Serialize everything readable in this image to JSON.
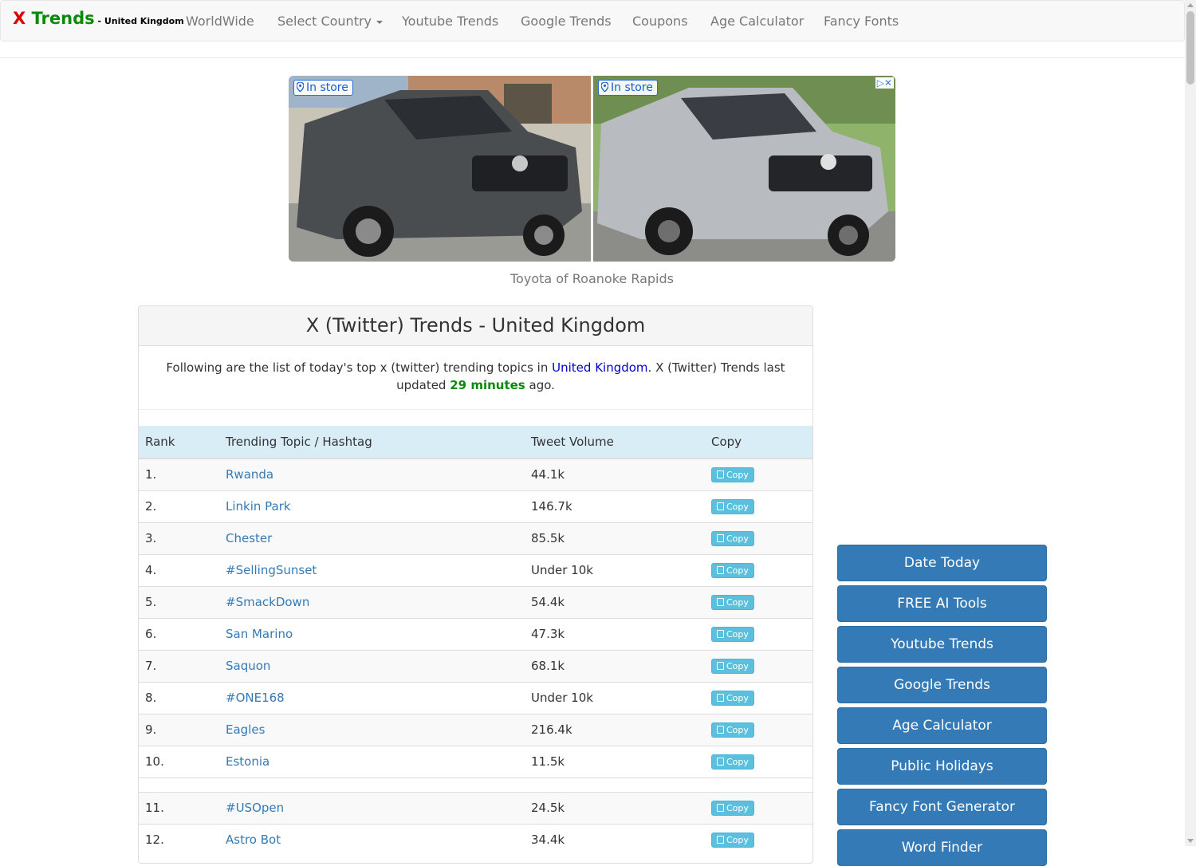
{
  "brand": {
    "x": "X",
    "trends": " Trends",
    "country": " - United Kingdom"
  },
  "nav": {
    "worldwide": "WorldWide",
    "select_country": "Select Country",
    "youtube_trends": "Youtube Trends",
    "google_trends": "Google Trends",
    "coupons": "Coupons",
    "age_calculator": "Age Calculator",
    "fancy_fonts": "Fancy Fonts"
  },
  "ad": {
    "badge": "In store",
    "caption": "Toyota of Roanoke Rapids"
  },
  "panel": {
    "title": "X (Twitter) Trends - United Kingdom",
    "intro_before": "Following are the list of today's top x (twitter) trending topics in ",
    "intro_country": "United Kingdom",
    "intro_middle": ". X (Twitter) Trends last updated ",
    "intro_time": "29 minutes",
    "intro_after": " ago."
  },
  "table": {
    "headers": [
      "Rank",
      "Trending Topic / Hashtag",
      "Tweet Volume",
      "Copy"
    ],
    "copy_label": "Copy",
    "rows": [
      {
        "rank": "1.",
        "topic": "Rwanda",
        "volume": "44.1k"
      },
      {
        "rank": "2.",
        "topic": "Linkin Park",
        "volume": "146.7k"
      },
      {
        "rank": "3.",
        "topic": "Chester",
        "volume": "85.5k"
      },
      {
        "rank": "4.",
        "topic": "#SellingSunset",
        "volume": "Under 10k"
      },
      {
        "rank": "5.",
        "topic": "#SmackDown",
        "volume": "54.4k"
      },
      {
        "rank": "6.",
        "topic": "San Marino",
        "volume": "47.3k"
      },
      {
        "rank": "7.",
        "topic": "Saquon",
        "volume": "68.1k"
      },
      {
        "rank": "8.",
        "topic": "#ONE168",
        "volume": "Under 10k"
      },
      {
        "rank": "9.",
        "topic": "Eagles",
        "volume": "216.4k"
      },
      {
        "rank": "10.",
        "topic": "Estonia",
        "volume": "11.5k"
      },
      {
        "rank": "11.",
        "topic": "#USOpen",
        "volume": "24.5k"
      },
      {
        "rank": "12.",
        "topic": "Astro Bot",
        "volume": "34.4k"
      }
    ]
  },
  "sidebar": {
    "items": [
      "Date Today",
      "FREE AI Tools",
      "Youtube Trends",
      "Google Trends",
      "Age Calculator",
      "Public Holidays",
      "Fancy Font Generator",
      "Word Finder"
    ]
  }
}
